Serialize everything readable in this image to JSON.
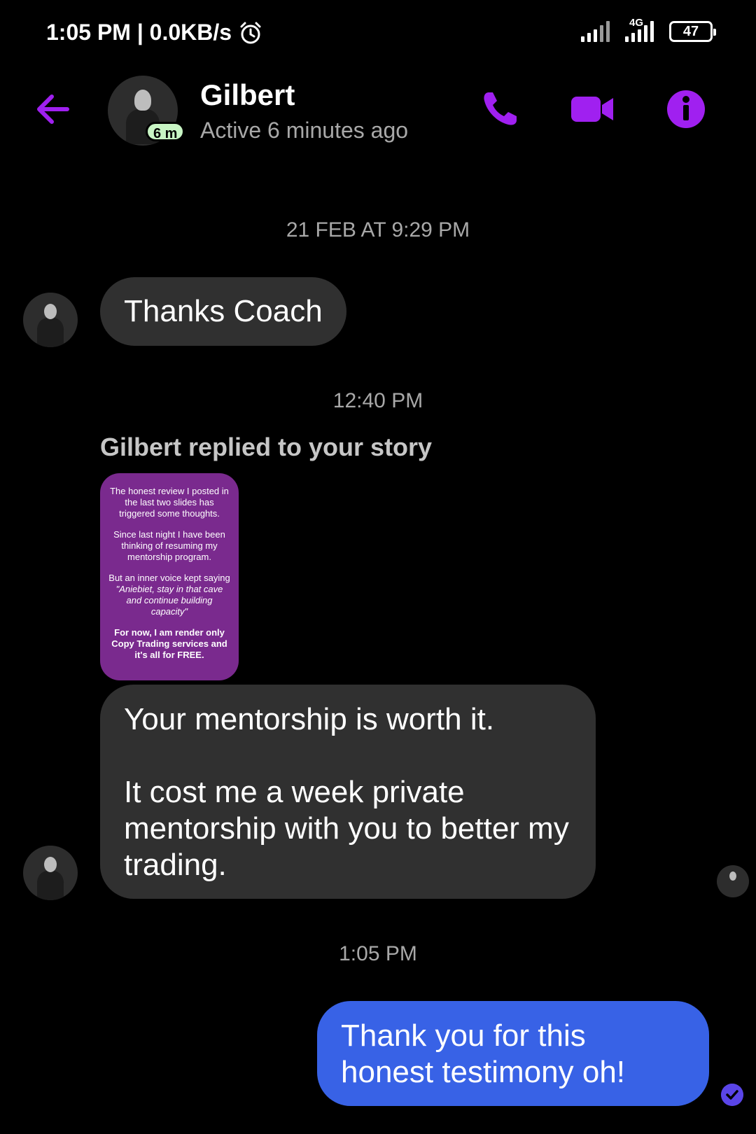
{
  "status_bar": {
    "time_and_speed": "1:05 PM | 0.0KB/s",
    "network": "4G",
    "battery": "47"
  },
  "header": {
    "contact_name": "Gilbert",
    "contact_status": "Active 6 minutes ago",
    "active_badge": "6 m",
    "accent_color": "#a020f0"
  },
  "chat": {
    "timestamp_1": "21 FEB AT 9:29 PM",
    "message_1": "Thanks Coach",
    "timestamp_2": "12:40 PM",
    "reply_label": "Gilbert replied to your story",
    "story": {
      "para1": "The honest review I posted in the last two slides has triggered some thoughts.",
      "para2": "Since last night I have been thinking of resuming my mentorship program.",
      "para3_plain": "But an inner voice kept saying ",
      "para3_italic": "\"Aniebiet, stay in that cave and continue building capacity\"",
      "para4": "For now, I am render only Copy Trading services and it's all for FREE."
    },
    "message_2": "Your mentorship is worth it.\n\nIt cost me a week private mentorship with you to better my trading.",
    "timestamp_3": "1:05 PM",
    "message_3": "Thank you for this honest testimony oh!",
    "outgoing_color": "#3862e6"
  }
}
